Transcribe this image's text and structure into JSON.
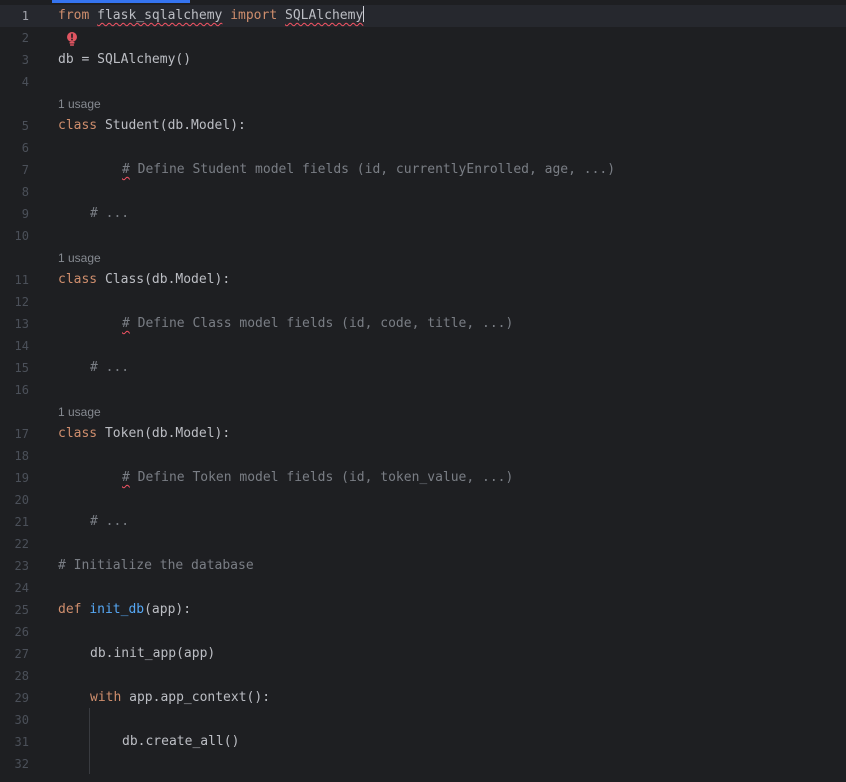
{
  "editor": {
    "inlay_hint": "1 usage",
    "line_numbers": [
      "1",
      "2",
      "3",
      "4",
      "5",
      "6",
      "7",
      "8",
      "9",
      "10",
      "11",
      "12",
      "13",
      "14",
      "15",
      "16",
      "17",
      "18",
      "19",
      "20",
      "21",
      "22",
      "23",
      "24",
      "25",
      "26",
      "27",
      "28",
      "29",
      "30",
      "31",
      "32"
    ],
    "code": {
      "l1_kw_from": "from",
      "l1_module": "flask_sqlalchemy",
      "l1_kw_import": "import",
      "l1_name": "SQLAlchemy",
      "l3": "db = SQLAlchemy()",
      "l5_kw": "class",
      "l5_rest": " Student(db.Model):",
      "l7_hash": "#",
      "l7_comment": " Define Student model fields (id, currentlyEnrolled, age, ...)",
      "l9": "# ...",
      "l11_kw": "class",
      "l11_rest": " Class(db.Model):",
      "l13_hash": "#",
      "l13_comment": " Define Class model fields (id, code, title, ...)",
      "l15": "# ...",
      "l17_kw": "class",
      "l17_rest": " Token(db.Model):",
      "l19_hash": "#",
      "l19_comment": " Define Token model fields (id, token_value, ...)",
      "l21": "# ...",
      "l23": "# Initialize the database",
      "l25_kw": "def",
      "l25_fn": "init_db",
      "l25_rest": "(app):",
      "l27": "db.init_app(app)",
      "l29_kw": "with",
      "l29_rest": " app.app_context():",
      "l31": "db.create_all()"
    },
    "colors": {
      "background": "#1e1f22",
      "keyword": "#cf8e6d",
      "function": "#56a8f5",
      "comment": "#7a7e85",
      "text": "#bcbec4",
      "error_underline": "#f75464",
      "progress": "#3574f0"
    },
    "icons": {
      "intention": "error-bulb-icon"
    }
  }
}
